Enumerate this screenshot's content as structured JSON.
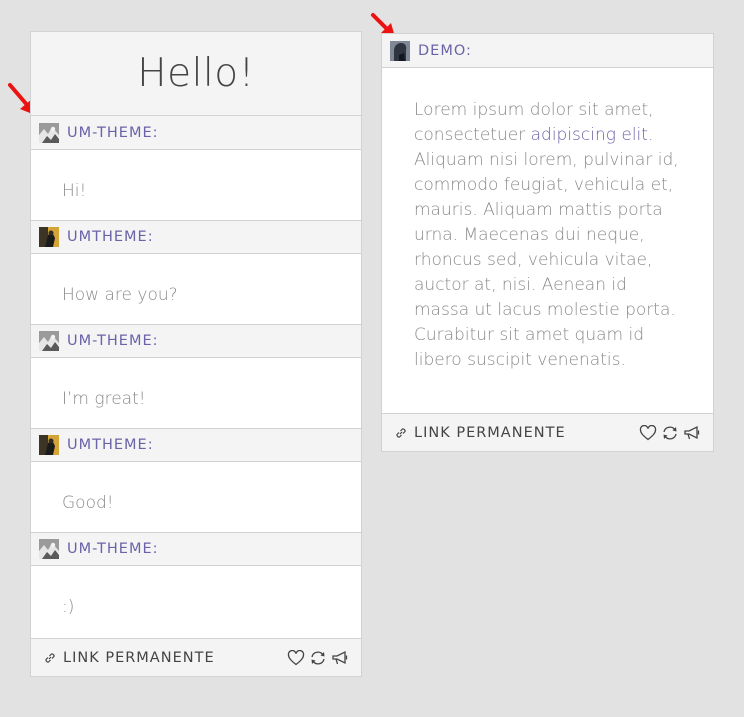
{
  "left_card": {
    "title": "Hello!",
    "messages": [
      {
        "author": "UM-THEME:",
        "avatar_icon": "um-theme-avatar-icon",
        "text": "Hi!"
      },
      {
        "author": "UMTHEME:",
        "avatar_icon": "umtheme-avatar-icon",
        "text": "How are you?"
      },
      {
        "author": "UM-THEME:",
        "avatar_icon": "um-theme-avatar-icon",
        "text": "I’m great!"
      },
      {
        "author": "UMTHEME:",
        "avatar_icon": "umtheme-avatar-icon",
        "text": "Good!"
      },
      {
        "author": "UM-THEME:",
        "avatar_icon": "um-theme-avatar-icon",
        "text": ":)"
      }
    ],
    "footer": {
      "permalink": "LINK PERMANENTE"
    }
  },
  "right_card": {
    "author": "DEMO:",
    "avatar_icon": "demo-avatar-icon",
    "body_before_link": "Lorem ipsum dolor sit amet, consectetuer ",
    "body_link": "adipiscing elit",
    "body_after_link": ". Aliquam nisi lorem, pulvinar id, commodo feugiat, vehicula et, mauris. Aliquam mattis porta urna. Maecenas dui neque, rhoncus sed, vehicula vitae, auctor at, nisi. Aenean id massa ut lacus molestie porta. Curabitur sit amet quam id libero suscipit venenatis.",
    "footer": {
      "permalink": "LINK PERMANENTE"
    }
  },
  "icons": {
    "permalink": "link-icon",
    "like": "heart-icon",
    "reblog": "reblog-icon",
    "share": "megaphone-icon",
    "pointer": "red-arrow-icon"
  },
  "colors": {
    "page_bg": "#e2e2e2",
    "card_bg": "#ffffff",
    "bar_bg": "#f4f4f4",
    "accent": "#6a63a8",
    "text": "#8a8a8a",
    "arrow": "#ee1111"
  }
}
